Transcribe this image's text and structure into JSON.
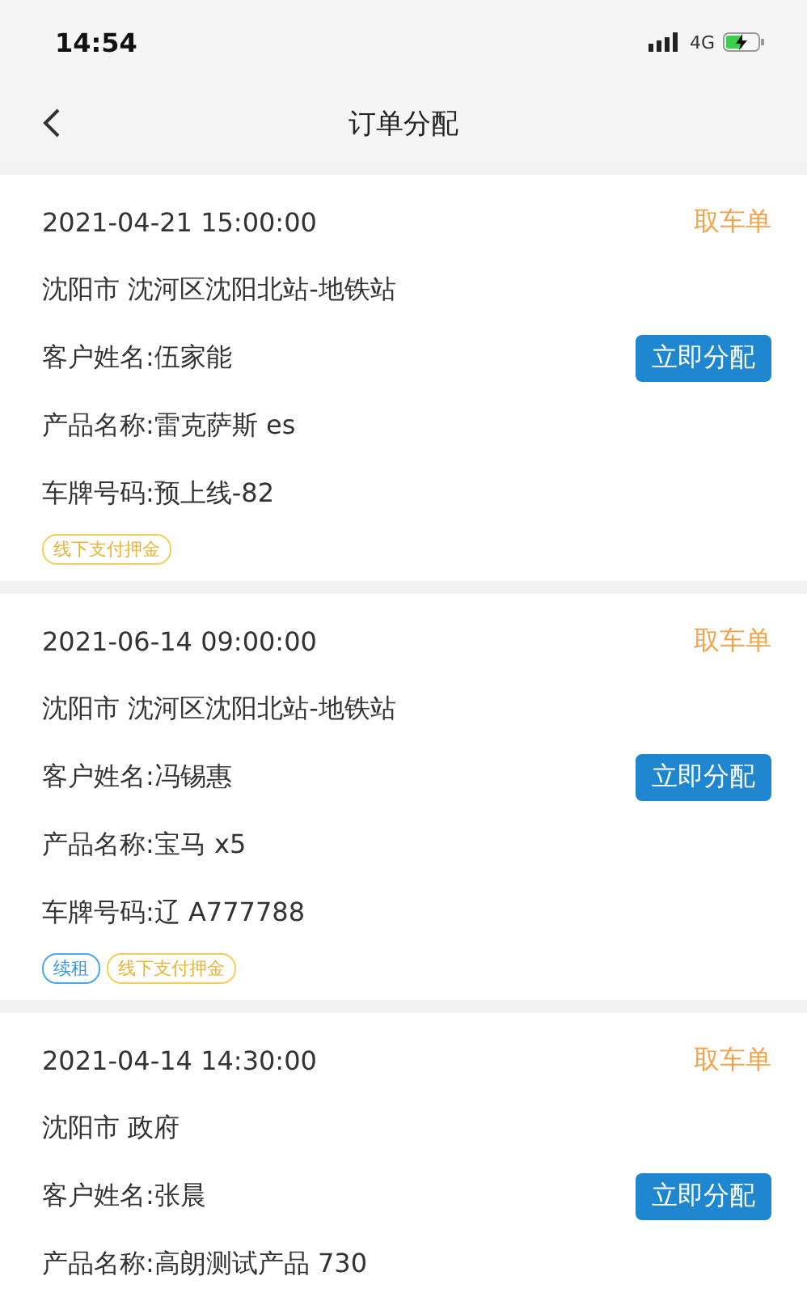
{
  "status_bar": {
    "time": "14:54",
    "network": "4G"
  },
  "nav": {
    "title": "订单分配"
  },
  "orders": [
    {
      "datetime": "2021-04-21 15:00:00",
      "type": "取车单",
      "address": "沈阳市 沈河区沈阳北站-地铁站",
      "customer": "客户姓名:伍家能",
      "action": "立即分配",
      "product": "产品名称:雷克萨斯 es",
      "plate": "车牌号码:预上线-82",
      "tags": [
        {
          "label": "线下支付押金",
          "kind": "deposit"
        }
      ]
    },
    {
      "datetime": "2021-06-14 09:00:00",
      "type": "取车单",
      "address": "沈阳市 沈河区沈阳北站-地铁站",
      "customer": "客户姓名:冯锡惠",
      "action": "立即分配",
      "product": "产品名称:宝马 x5",
      "plate": "车牌号码:辽 A777788",
      "tags": [
        {
          "label": "续租",
          "kind": "renew"
        },
        {
          "label": "线下支付押金",
          "kind": "deposit"
        }
      ]
    },
    {
      "datetime": "2021-04-14 14:30:00",
      "type": "取车单",
      "address": "沈阳市 政府",
      "customer": "客户姓名:张晨",
      "action": "立即分配",
      "product": "产品名称:高朗测试产品 730"
    }
  ]
}
